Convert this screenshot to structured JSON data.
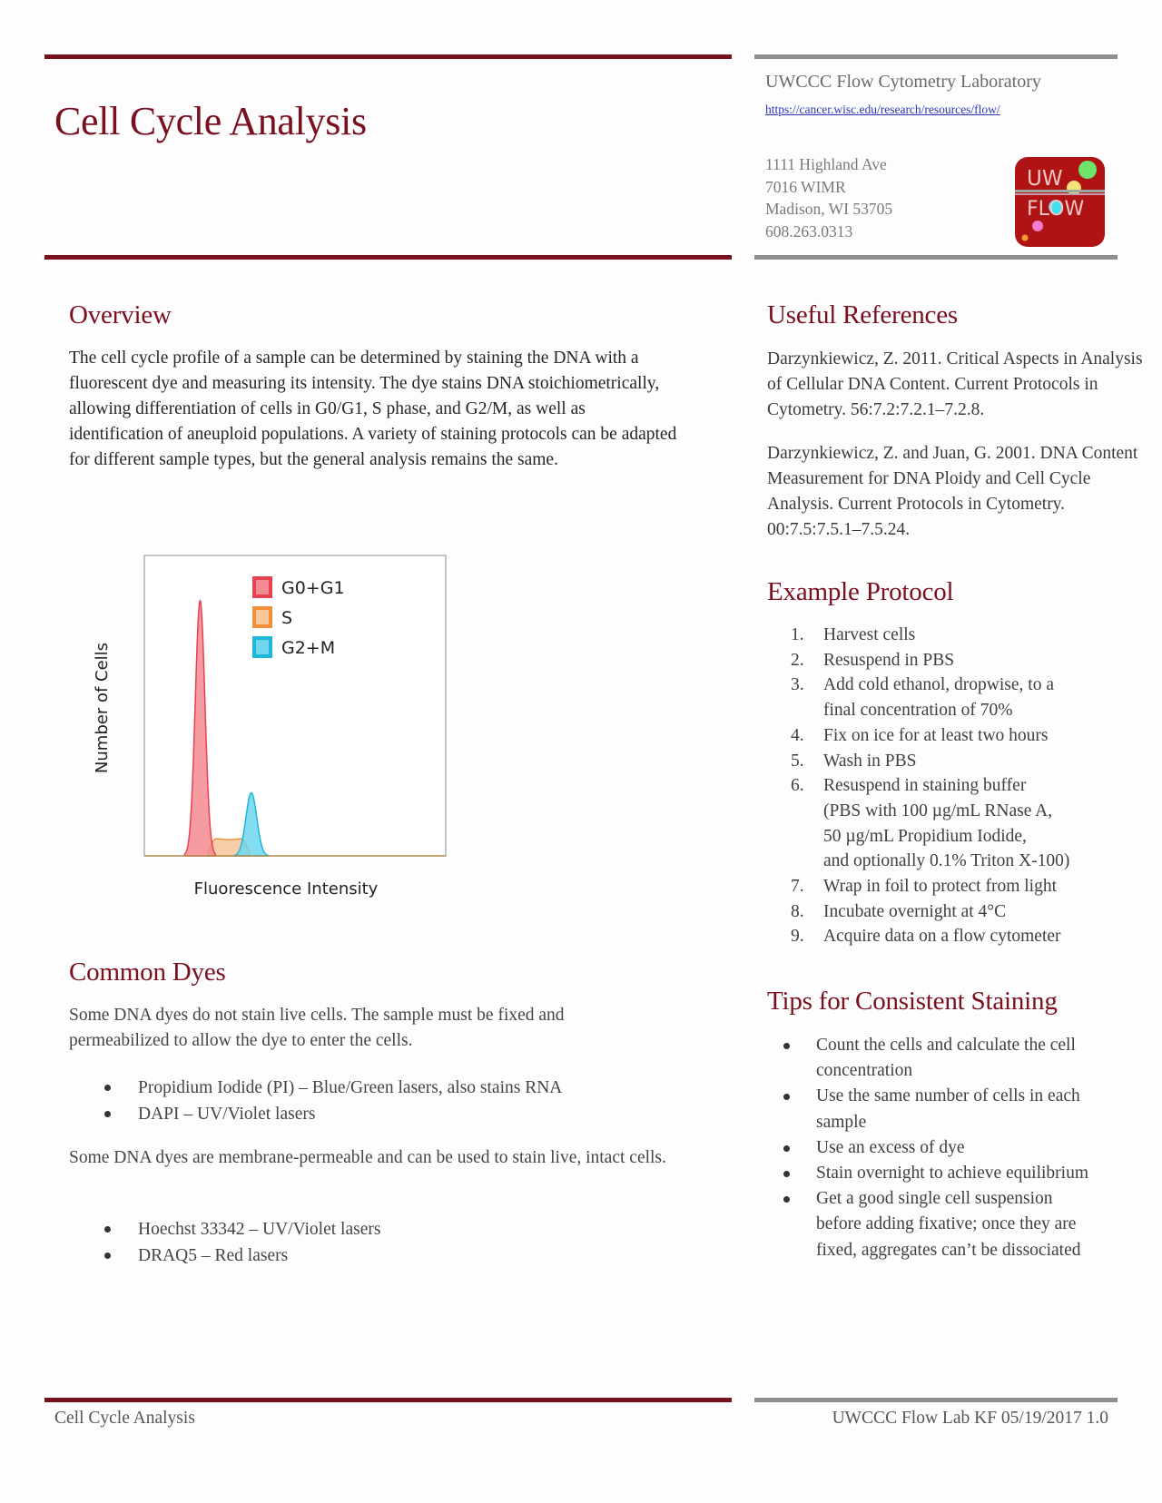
{
  "header": {
    "title": "Cell Cycle Analysis",
    "lab_name": "UWCCC Flow Cytometry Laboratory",
    "lab_url": "https://cancer.wisc.edu/research/resources/flow/",
    "address": [
      "1111 Highland Ave",
      "7016 WIMR",
      "Madison, WI 53705",
      "608.263.0313"
    ],
    "logo": {
      "line1": "UW",
      "line2": "FLOW",
      "background": "#b01313"
    }
  },
  "colors": {
    "accent": "#7a0f1e",
    "rule_gray": "#8e8e8e",
    "link": "#2a35b8"
  },
  "overview": {
    "heading": "Overview",
    "text": "The cell cycle profile of a sample can be determined by staining the DNA with a fluorescent dye and measuring its intensity. The dye stains DNA stoichiometrically, allowing differentiation of cells in G0/G1, S phase, and G2/M, as well as identification of aneuploid populations. A variety of staining protocols can be adapted for different sample types, but the general analysis remains the same."
  },
  "chart_data": {
    "type": "area",
    "title": "",
    "xlabel": "Fluorescence Intensity",
    "ylabel": "Number of Cells",
    "x_ticks": [],
    "y_ticks": [],
    "xlim": [
      0,
      100
    ],
    "ylim": [
      0,
      100
    ],
    "grid": false,
    "legend_position": "top-right",
    "series": [
      {
        "name": "G0+G1",
        "color": "#e8414f",
        "fill": "#f48a92",
        "shape": "gaussian",
        "center": 18.5,
        "width": 1.6,
        "peak": 85
      },
      {
        "name": "S",
        "color": "#f0913a",
        "fill": "#f7c69a",
        "shape": "plateau",
        "start": 22,
        "end": 34,
        "peak": 6
      },
      {
        "name": "G2+M",
        "color": "#1fb7d9",
        "fill": "#6fd6ee",
        "shape": "gaussian",
        "center": 35.5,
        "width": 1.8,
        "peak": 21
      }
    ]
  },
  "common_dyes": {
    "heading": "Common Dyes",
    "intro_fixed": "Some DNA dyes do not stain live cells. The sample must be fixed and permeabilized to allow the dye to enter the cells.",
    "fixed_dyes": [
      "Propidium Iodide (PI) – Blue/Green lasers, also stains RNA",
      "DAPI – UV/Violet lasers"
    ],
    "intro_live": "Some DNA dyes are membrane-permeable and can be used to stain live, intact cells.",
    "live_dyes": [
      "Hoechst 33342 – UV/Violet lasers",
      "DRAQ5 – Red lasers"
    ]
  },
  "references": {
    "heading": "Useful References",
    "items": [
      "Darzynkiewicz, Z. 2011. Critical Aspects in Analysis of Cellular DNA Content. Current Protocols in Cytometry. 56:7.2:7.2.1–7.2.8.",
      "Darzynkiewicz, Z. and Juan, G. 2001. DNA Content Measurement for DNA Ploidy and Cell Cycle Analysis. Current Protocols in Cytometry. 00:7.5:7.5.1–7.5.24."
    ]
  },
  "protocol": {
    "heading": "Example Protocol",
    "steps": [
      {
        "num": "1.",
        "lines": [
          "Harvest cells"
        ]
      },
      {
        "num": "2.",
        "lines": [
          "Resuspend in PBS"
        ]
      },
      {
        "num": "3.",
        "lines": [
          "Add cold ethanol, dropwise, to a",
          "final concentration of 70%"
        ]
      },
      {
        "num": "4.",
        "lines": [
          "Fix on ice for at least two hours"
        ]
      },
      {
        "num": "5.",
        "lines": [
          "Wash in PBS"
        ]
      },
      {
        "num": "6.",
        "lines": [
          "Resuspend in staining buffer",
          "(PBS with 100 µg/mL RNase A,",
          "50 µg/mL Propidium Iodide,",
          "and optionally 0.1% Triton X-100)"
        ]
      },
      {
        "num": "7.",
        "lines": [
          "Wrap in foil to protect from light"
        ]
      },
      {
        "num": "8.",
        "lines": [
          "Incubate overnight at 4°C"
        ]
      },
      {
        "num": "9.",
        "lines": [
          "Acquire data on a flow cytometer"
        ]
      }
    ]
  },
  "tips": {
    "heading": "Tips for Consistent Staining",
    "items": [
      [
        "Count the cells and calculate the cell",
        "concentration"
      ],
      [
        "Use the same number of cells in each",
        "sample"
      ],
      [
        "Use an excess of dye"
      ],
      [
        "Stain overnight to achieve equilibrium"
      ],
      [
        "Get a good single cell suspension",
        "before adding fixative; once they are",
        "fixed, aggregates can’t be dissociated"
      ]
    ]
  },
  "footer": {
    "left": "Cell Cycle Analysis",
    "right": "UWCCC Flow Lab KF 05/19/2017 1.0"
  }
}
